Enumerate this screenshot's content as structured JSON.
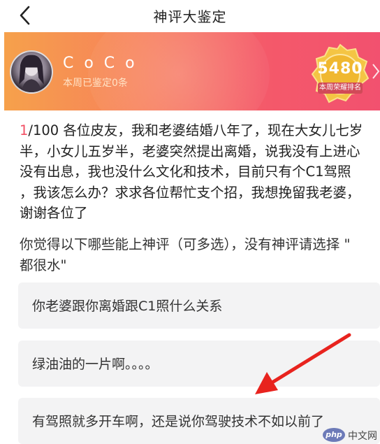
{
  "navbar": {
    "title": "神评大鉴定"
  },
  "banner": {
    "user_name": "C o C o",
    "user_sub": "本周已鉴定0条",
    "badge_number": "5480",
    "badge_label": "本周荣耀排名"
  },
  "question": {
    "index": "1",
    "total": "/100",
    "text": " 各位皮友，我和老婆结婚八年了，现在大女儿七岁\n半，小女儿五岁半，老婆突然提出离婚，说我没有上进心\n没有出息，我也没什么文化和技术，目前只有个C1驾照\n，我该怎么办？求求各位帮忙支个招，我想挽留我老婆，\n谢谢各位了"
  },
  "prompt": "你觉得以下哪些能上神评（可多选），没有神评请选择 \"\n都很水\"",
  "options": [
    {
      "label": "你老婆跟你离婚跟C1照什么关系"
    },
    {
      "label": "绿油油的一片啊。。。。"
    },
    {
      "label": "有驾照就多开车啊，还是说你驾驶技术不如以前了"
    }
  ],
  "watermark": {
    "logo": "php",
    "text": "中文网"
  },
  "colors": {
    "accent": "#f25064",
    "arrow": "#e8231e",
    "banner_start": "#f6a14b",
    "banner_end": "#f2516f"
  }
}
